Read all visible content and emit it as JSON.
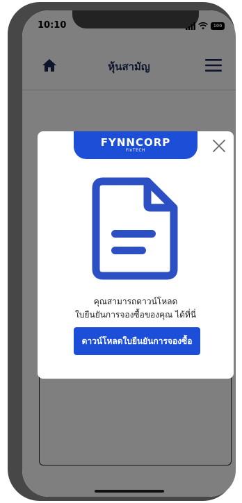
{
  "status_bar": {
    "time": "10:10",
    "battery": "100"
  },
  "header": {
    "title": "หุ้นสามัญ"
  },
  "modal": {
    "brand": "FYNNCORP",
    "brand_sub": "FinTECH",
    "message_line1": "คุณสามารถดาวน์โหลด",
    "message_line2": "ใบยืนยันการจองซื้อของคุณ ได้ที่นี่",
    "download_button": "ดาวน์โหลดใบยืนยันการจองซื้อ"
  },
  "colors": {
    "accent": "#1d4ed8",
    "nav_icon": "#1a2a5a",
    "doc_icon": "#2d4fc4"
  },
  "icons": [
    "home-icon",
    "menu-icon",
    "close-icon",
    "document-icon",
    "signal-icon",
    "wifi-icon",
    "battery-icon"
  ]
}
